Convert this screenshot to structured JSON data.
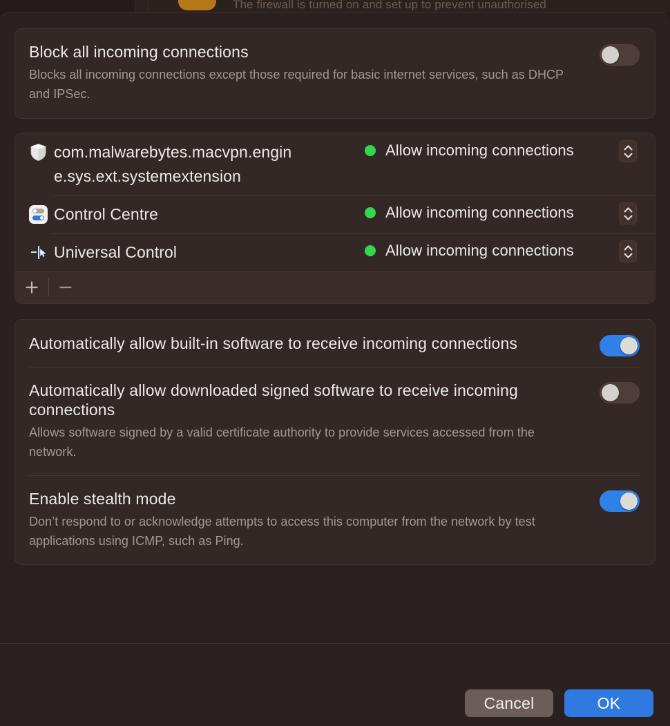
{
  "background": {
    "partial_notice": "The firewall is turned on and set up to prevent unauthorised"
  },
  "dialog": {
    "block_all": {
      "title": "Block all incoming connections",
      "subtitle": "Blocks all incoming connections except those required for basic internet services, such as DHCP and IPSec.",
      "toggle_state": "off"
    },
    "app_list": {
      "state_label": "Allow incoming connections",
      "status_color": "#32d74b",
      "apps": [
        {
          "name": "com.malwarebytes.macvpn.engine.sys.ext.systemextension",
          "icon": "shield-icon",
          "state": "Allow incoming connections"
        },
        {
          "name": "Control Centre",
          "icon": "control-centre-icon",
          "state": "Allow incoming connections"
        },
        {
          "name": "Universal Control",
          "icon": "universal-control-icon",
          "state": "Allow incoming connections"
        }
      ],
      "toolbar": {
        "add_label": "+",
        "remove_label": "−"
      }
    },
    "options": [
      {
        "title": "Automatically allow built-in software to receive incoming connections",
        "subtitle": "",
        "toggle_state": "on"
      },
      {
        "title": "Automatically allow downloaded signed software to receive incoming connections",
        "subtitle": "Allows software signed by a valid certificate authority to provide services accessed from the network.",
        "toggle_state": "off"
      },
      {
        "title": "Enable stealth mode",
        "subtitle": "Don’t respond to or acknowledge attempts to access this computer from the network by test applications using ICMP, such as Ping.",
        "toggle_state": "on"
      }
    ],
    "footer": {
      "cancel_label": "Cancel",
      "ok_label": "OK",
      "accent_color": "#2f7ae0"
    }
  }
}
